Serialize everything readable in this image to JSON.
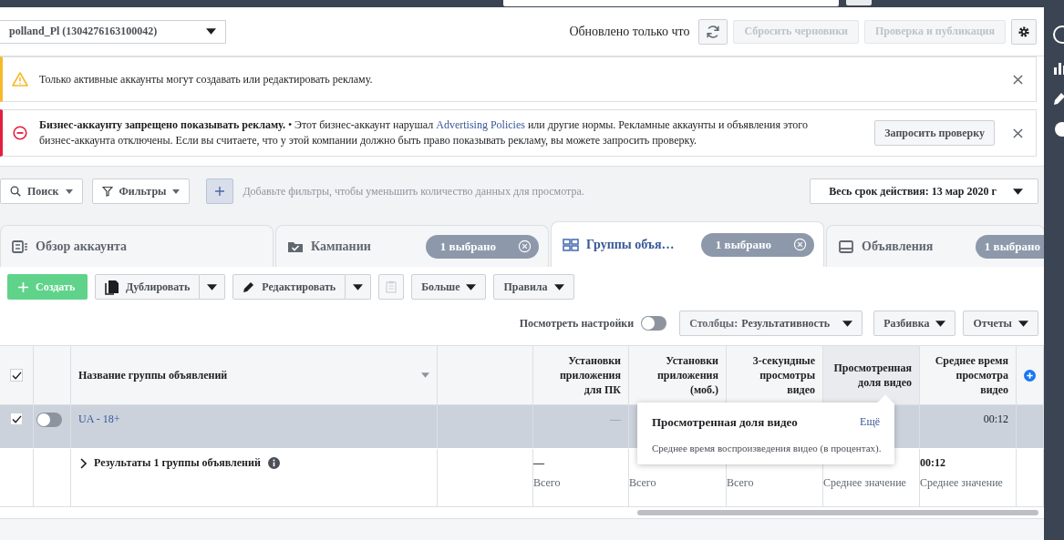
{
  "account_selector": {
    "label": "polland_Pl (1304276163100042)"
  },
  "header": {
    "status": "Обновлено только что",
    "buttons": [
      {
        "label": "Сбросить черновики",
        "disabled": true
      },
      {
        "label": "Проверка и публикация",
        "disabled": true
      }
    ]
  },
  "alerts": [
    {
      "kind": "warning",
      "text": "Только активные аккаунты могут создавать или редактировать рекламу."
    },
    {
      "kind": "error",
      "text": "**Бизнес-аккаунту запрещено показывать рекламу.** • Этот бизнес-аккаунт нарушал ",
      "link": "Advertising Policies",
      "text_after": " или другие нормы. Рекламные аккаунты и объявления этого бизнес-аккаунта отключены. Если вы считаете, что у этой компании должно быть право показывать рекламу, вы можете запросить проверку.",
      "button": "Запросить проверку"
    }
  ],
  "filter_bar": {
    "search": "Поиск",
    "filters": "Фильтры",
    "hint": "Добавьте фильтры, чтобы уменьшить количество данных для просмотра.",
    "date_range": "Весь срок действия: 13 мар 2020 г"
  },
  "tabs": [
    {
      "label": "Обзор аккаунта",
      "selected": false
    },
    {
      "label": "Кампании",
      "badge": "1 выбрано",
      "selected": false
    },
    {
      "label": "Группы объя…",
      "badge": "1 выбрано",
      "selected": true
    },
    {
      "label": "Объявления",
      "badge": "1 выбрано",
      "selected": false
    }
  ],
  "actions": {
    "create": "Создать",
    "duplicate": "Дублировать",
    "edit": "Редактировать",
    "paste_disabled": true,
    "more": "Больше",
    "rules": "Правила"
  },
  "view_bar": {
    "settings_label": "Посмотреть настройки",
    "settings_on": false,
    "columns_prefix": "Столбцы: ",
    "columns_value": "Результативность",
    "breakdown": "Разбивка",
    "reports": "Отчеты"
  },
  "table": {
    "all_checked": true,
    "name_column": "Название группы объявлений",
    "columns": [
      {
        "label": "Установки приложения для ПК",
        "highlighted": false
      },
      {
        "label": "Установки приложения (моб.)",
        "highlighted": false
      },
      {
        "label": "3-секундные просмотры видео",
        "highlighted": false
      },
      {
        "label": "Просмотренная доля видео",
        "highlighted": true
      },
      {
        "label": "Среднее время просмотра видео",
        "highlighted": false
      }
    ],
    "rows": [
      {
        "name": "UA - 18+",
        "checked": true,
        "on": false,
        "selected": true,
        "cells": [
          "—",
          null,
          null,
          null,
          "00:12"
        ]
      }
    ],
    "summary": {
      "label": "Результаты 1 группы объявлений",
      "cells": [
        {
          "value": "—",
          "note": "Всего"
        },
        {
          "note": "Всего"
        },
        {
          "note": "Всего"
        },
        {
          "note": "Среднее значение"
        },
        {
          "value": "00:12",
          "note": "Среднее значение"
        }
      ]
    }
  },
  "tooltip": {
    "title": "Просмотренная доля видео",
    "link": "Ещё",
    "text": "Среднее время воспроизведения видео (в процентах)."
  }
}
